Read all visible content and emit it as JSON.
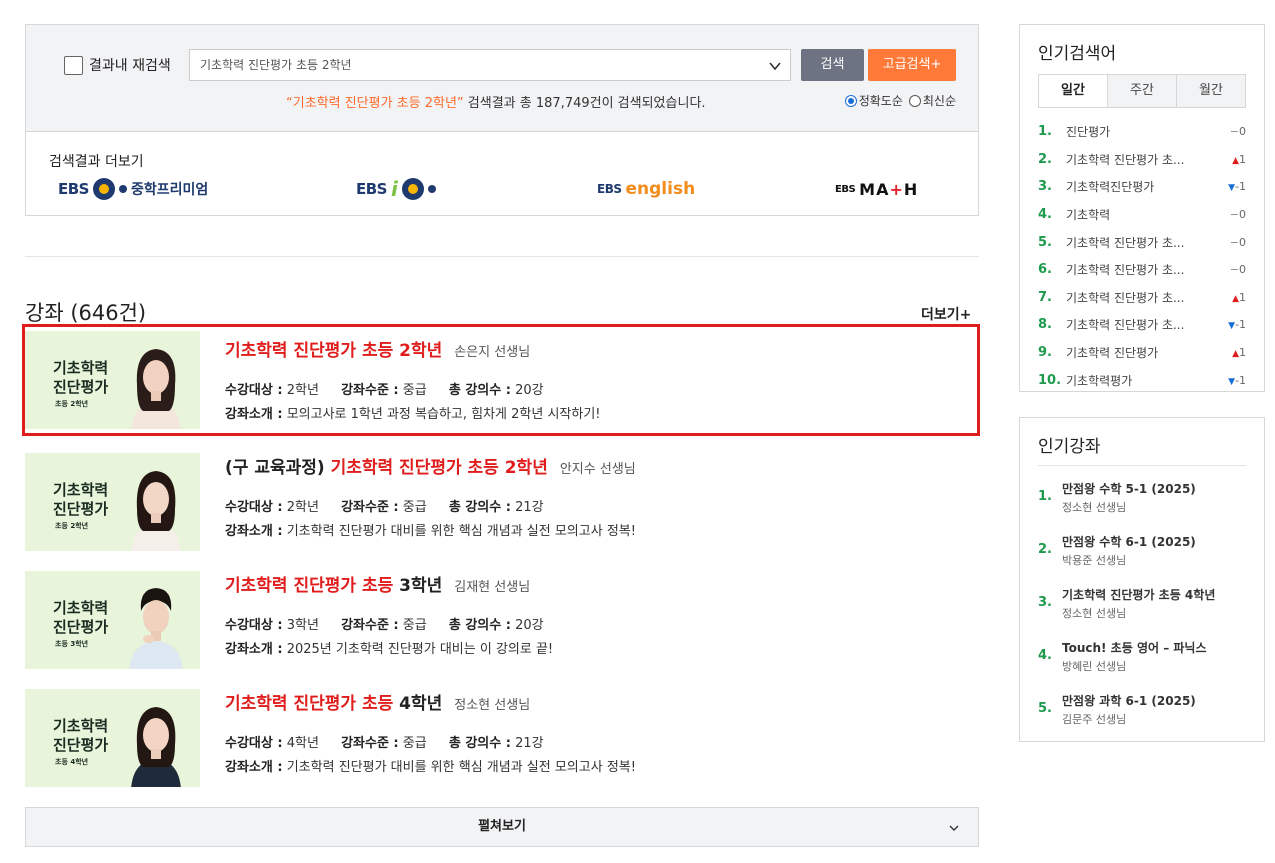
{
  "search": {
    "recheck_label": "결과내 재검색",
    "query": "기초학력 진단평가 초등 2학년",
    "search_button": "검색",
    "advanced_button": "고급검색+",
    "result_keyword": "“기초학력 진단평가 초등 2학년”",
    "result_suffix": " 검색결과 총 187,749건이 검색되었습니다.",
    "sort_accuracy": "정확도순",
    "sort_latest": "최신순",
    "more_title": "검색결과 더보기",
    "brands": {
      "premium_ebs": "EBS",
      "premium_text": "중학프리미엄",
      "ebsi_ebs": "EBS",
      "ebsi_i": "i",
      "english_ebs": "EBS",
      "english_text": "english",
      "math_ebs": "EBS",
      "math_text_1": "MA",
      "math_plus": "+",
      "math_text_2": "H"
    }
  },
  "courses": {
    "section_title": "강좌 (646건)",
    "more_link": "더보기+",
    "items": [
      {
        "prefix": "",
        "title_red": "기초학력 진단평가 초등 2학년",
        "title_black": "",
        "teacher": "손은지 선생님",
        "target_label": "수강대상 :",
        "target": "2학년",
        "level_label": "강좌수준 :",
        "level": "중급",
        "count_label": "총 강의수 :",
        "count": "20강",
        "desc_label": "강좌소개 :",
        "desc": "모의고사로 1학년 과정 복습하고, 힘차게 2학년 시작하기!",
        "thumb_title_1": "기초학력",
        "thumb_title_2": "진단평가",
        "thumb_sub": "초등 2학년"
      },
      {
        "prefix": "(구 교육과정) ",
        "title_red": "기초학력 진단평가 초등 2학년",
        "title_black": "",
        "teacher": "안지수 선생님",
        "target_label": "수강대상 :",
        "target": "2학년",
        "level_label": "강좌수준 :",
        "level": "중급",
        "count_label": "총 강의수 :",
        "count": "21강",
        "desc_label": "강좌소개 :",
        "desc": "기초학력 진단평가 대비를 위한 핵심 개념과 실전 모의고사 정복!",
        "thumb_title_1": "기초학력",
        "thumb_title_2": "진단평가",
        "thumb_sub": "초등 2학년"
      },
      {
        "prefix": "",
        "title_red": "기초학력 진단평가 초등 ",
        "title_black": "3학년",
        "teacher": "김재현 선생님",
        "target_label": "수강대상 :",
        "target": "3학년",
        "level_label": "강좌수준 :",
        "level": "중급",
        "count_label": "총 강의수 :",
        "count": "20강",
        "desc_label": "강좌소개 :",
        "desc": "2025년 기초학력 진단평가 대비는 이 강의로 끝!",
        "thumb_title_1": "기초학력",
        "thumb_title_2": "진단평가",
        "thumb_sub": "초등 3학년"
      },
      {
        "prefix": "",
        "title_red": "기초학력 진단평가 초등 ",
        "title_black": "4학년",
        "teacher": "정소현 선생님",
        "target_label": "수강대상 :",
        "target": "4학년",
        "level_label": "강좌수준 :",
        "level": "중급",
        "count_label": "총 강의수 :",
        "count": "21강",
        "desc_label": "강좌소개 :",
        "desc": "기초학력 진단평가 대비를 위한 핵심 개념과 실전 모의고사 정복!",
        "thumb_title_1": "기초학력",
        "thumb_title_2": "진단평가",
        "thumb_sub": "초등 4학년"
      }
    ],
    "expand_label": "펼쳐보기"
  },
  "popular_keywords": {
    "title": "인기검색어",
    "tabs": [
      "일간",
      "주간",
      "월간"
    ],
    "items": [
      {
        "rank": "1.",
        "text": "진단평가",
        "arrow": "−",
        "change": "0",
        "dir": "same"
      },
      {
        "rank": "2.",
        "text": "기초학력 진단평가 초...",
        "arrow": "▲",
        "change": "1",
        "dir": "up"
      },
      {
        "rank": "3.",
        "text": "기초학력진단평가",
        "arrow": "▼",
        "change": "-1",
        "dir": "down"
      },
      {
        "rank": "4.",
        "text": "기초학력",
        "arrow": "−",
        "change": "0",
        "dir": "same"
      },
      {
        "rank": "5.",
        "text": "기초학력 진단평가 초...",
        "arrow": "−",
        "change": "0",
        "dir": "same"
      },
      {
        "rank": "6.",
        "text": "기초학력 진단평가 초...",
        "arrow": "−",
        "change": "0",
        "dir": "same"
      },
      {
        "rank": "7.",
        "text": "기초학력 진단평가 초...",
        "arrow": "▲",
        "change": "1",
        "dir": "up"
      },
      {
        "rank": "8.",
        "text": "기초학력 진단평가 초...",
        "arrow": "▼",
        "change": "-1",
        "dir": "down"
      },
      {
        "rank": "9.",
        "text": "기초학력 진단평가",
        "arrow": "▲",
        "change": "1",
        "dir": "up"
      },
      {
        "rank": "10.",
        "text": "기초학력평가",
        "arrow": "▼",
        "change": "-1",
        "dir": "down"
      }
    ]
  },
  "popular_courses": {
    "title": "인기강좌",
    "items": [
      {
        "rank": "1.",
        "name": "만점왕 수학 5-1 (2025)",
        "teacher": "정소현 선생님"
      },
      {
        "rank": "2.",
        "name": "만점왕 수학 6-1 (2025)",
        "teacher": "박용준 선생님"
      },
      {
        "rank": "3.",
        "name": "기초학력 진단평가 초등 4학년",
        "teacher": "정소현 선생님"
      },
      {
        "rank": "4.",
        "name": "Touch! 초등 영어 – 파닉스",
        "teacher": "방혜린 선생님"
      },
      {
        "rank": "5.",
        "name": "만점왕 과학 6-1 (2025)",
        "teacher": "김문주 선생님"
      }
    ]
  },
  "colors": {
    "accent_orange": "#ff7a38",
    "title_red": "#e01d1d",
    "rank_green": "#1e9a4d",
    "button_gray": "#6d7382"
  }
}
